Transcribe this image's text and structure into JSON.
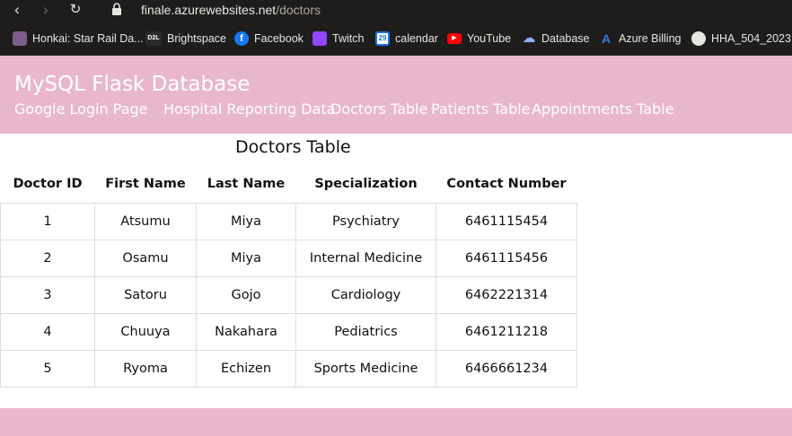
{
  "browser": {
    "url_host": "finale.azurewebsites.net",
    "url_path": "/doctors",
    "bookmarks": [
      {
        "label": "Honkai: Star Rail Da...",
        "icon": "honkai-icon",
        "color": "#7b5c8a"
      },
      {
        "label": "Brightspace",
        "icon": "d2l-icon",
        "color": "#2b2b2b"
      },
      {
        "label": "Facebook",
        "icon": "facebook-icon",
        "color": "#1877f2"
      },
      {
        "label": "Twitch",
        "icon": "twitch-icon",
        "color": "#9146ff"
      },
      {
        "label": "calendar",
        "icon": "calendar-icon",
        "color": "#1a73e8"
      },
      {
        "label": "YouTube",
        "icon": "youtube-icon",
        "color": "#ff0000"
      },
      {
        "label": "Database",
        "icon": "cloud-icon",
        "color": "#8ab4f8"
      },
      {
        "label": "Azure Billing",
        "icon": "azure-icon",
        "color": "#2a7fd4"
      },
      {
        "label": "HHA_504_2023",
        "icon": "github-icon",
        "color": "#e8e6e3"
      }
    ]
  },
  "site": {
    "title": "MySQL Flask Database",
    "nav": [
      "Google Login Page",
      "Hospital Reporting Data",
      "Doctors Table",
      "Patients Table",
      "Appointments Table"
    ],
    "accent_color": "#e9b7cc"
  },
  "main": {
    "heading": "Doctors Table",
    "columns": [
      "Doctor ID",
      "First Name",
      "Last Name",
      "Specialization",
      "Contact Number"
    ],
    "rows": [
      [
        "1",
        "Atsumu",
        "Miya",
        "Psychiatry",
        "6461115454"
      ],
      [
        "2",
        "Osamu",
        "Miya",
        "Internal Medicine",
        "6461115456"
      ],
      [
        "3",
        "Satoru",
        "Gojo",
        "Cardiology",
        "6462221314"
      ],
      [
        "4",
        "Chuuya",
        "Nakahara",
        "Pediatrics",
        "6461211218"
      ],
      [
        "5",
        "Ryoma",
        "Echizen",
        "Sports Medicine",
        "6466661234"
      ]
    ]
  }
}
